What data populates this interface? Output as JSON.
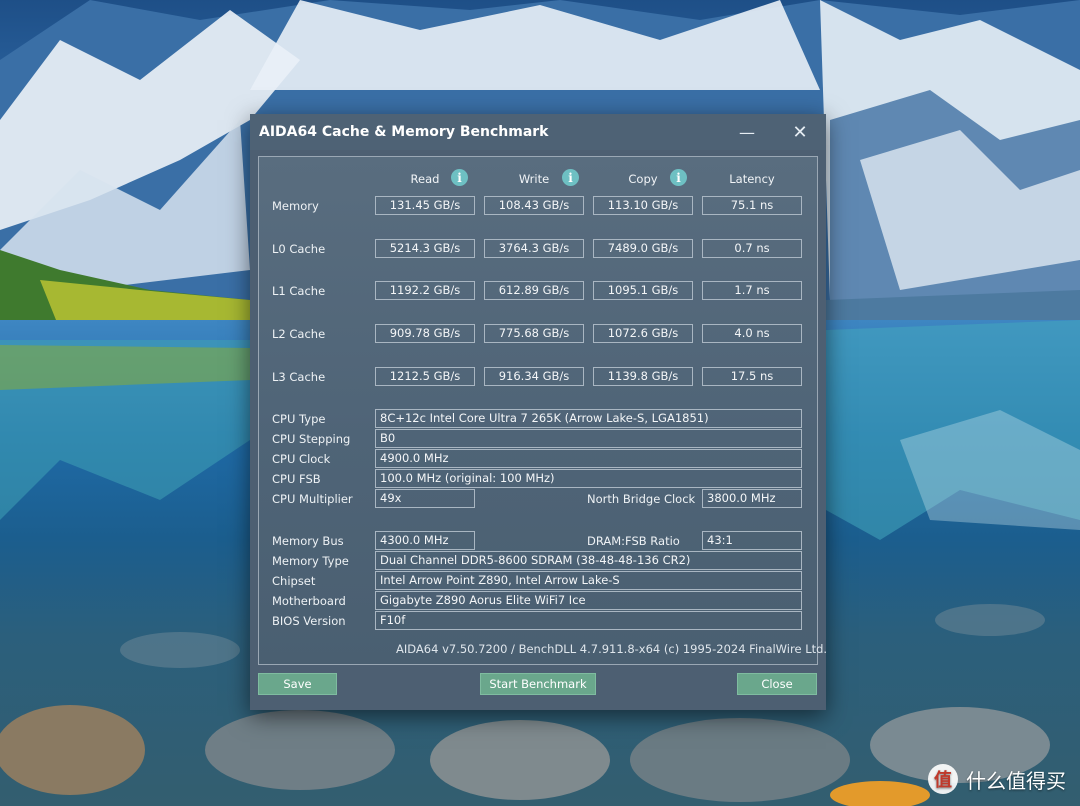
{
  "window": {
    "title": "AIDA64 Cache & Memory Benchmark",
    "minimize_glyph": "—",
    "close_glyph": "✕"
  },
  "columns": {
    "read": "Read",
    "write": "Write",
    "copy": "Copy",
    "latency": "Latency",
    "info_glyph": "i"
  },
  "bench": {
    "memory": {
      "label": "Memory",
      "read": "131.45 GB/s",
      "write": "108.43 GB/s",
      "copy": "113.10 GB/s",
      "latency": "75.1 ns"
    },
    "l0": {
      "label": "L0 Cache",
      "read": "5214.3 GB/s",
      "write": "3764.3 GB/s",
      "copy": "7489.0 GB/s",
      "latency": "0.7 ns"
    },
    "l1": {
      "label": "L1 Cache",
      "read": "1192.2 GB/s",
      "write": "612.89 GB/s",
      "copy": "1095.1 GB/s",
      "latency": "1.7 ns"
    },
    "l2": {
      "label": "L2 Cache",
      "read": "909.78 GB/s",
      "write": "775.68 GB/s",
      "copy": "1072.6 GB/s",
      "latency": "4.0 ns"
    },
    "l3": {
      "label": "L3 Cache",
      "read": "1212.5 GB/s",
      "write": "916.34 GB/s",
      "copy": "1139.8 GB/s",
      "latency": "17.5 ns"
    }
  },
  "cpu": {
    "type_label": "CPU Type",
    "type": "8C+12c Intel Core Ultra 7 265K  (Arrow Lake-S, LGA1851)",
    "stepping_label": "CPU Stepping",
    "stepping": "B0",
    "clock_label": "CPU Clock",
    "clock": "4900.0 MHz",
    "fsb_label": "CPU FSB",
    "fsb": "100.0 MHz  (original: 100 MHz)",
    "multiplier_label": "CPU Multiplier",
    "multiplier": "49x",
    "nb_clock_label": "North Bridge Clock",
    "nb_clock": "3800.0 MHz"
  },
  "system": {
    "bus_label": "Memory Bus",
    "bus": "4300.0 MHz",
    "ratio_label": "DRAM:FSB Ratio",
    "ratio": "43:1",
    "memtype_label": "Memory Type",
    "memtype": "Dual Channel DDR5-8600 SDRAM  (38-48-48-136 CR2)",
    "chipset_label": "Chipset",
    "chipset": "Intel Arrow Point Z890, Intel Arrow Lake-S",
    "board_label": "Motherboard",
    "board": "Gigabyte Z890 Aorus Elite WiFi7 Ice",
    "bios_label": "BIOS Version",
    "bios": "F10f"
  },
  "footer": {
    "copyright": "AIDA64 v7.50.7200 / BenchDLL 4.7.911.8-x64  (c) 1995-2024 FinalWire Ltd.",
    "save": "Save",
    "start": "Start Benchmark",
    "close": "Close"
  },
  "watermark": {
    "logo": "值",
    "text": "什么值得买"
  },
  "colors": {
    "accent_button": "#6aa78c",
    "info_icon": "#6ec0c3",
    "panel": "#4f6477"
  }
}
